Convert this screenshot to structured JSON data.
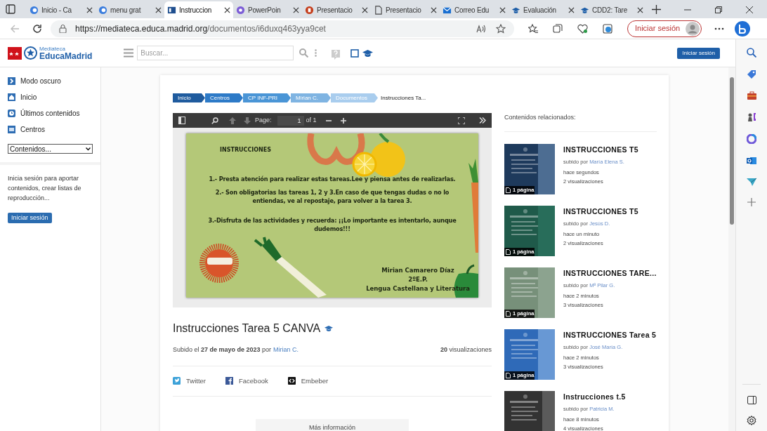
{
  "browser": {
    "tabs": [
      {
        "title": "Inicio - Ca",
        "kind": "edge",
        "selected": false
      },
      {
        "title": "menu grat",
        "kind": "edge",
        "selected": false
      },
      {
        "title": "Instruccion",
        "kind": "site",
        "selected": true
      },
      {
        "title": "PowerPoin",
        "kind": "copilot",
        "selected": false
      },
      {
        "title": "Presentacio",
        "kind": "ppt",
        "selected": false
      },
      {
        "title": "Presentacio",
        "kind": "doc",
        "selected": false
      },
      {
        "title": "Correo Edu",
        "kind": "mail",
        "selected": false
      },
      {
        "title": "Evaluación",
        "kind": "cap",
        "selected": false
      },
      {
        "title": "CDD2: Tare",
        "kind": "cap",
        "selected": false
      }
    ],
    "url_host": "https://mediateca.educa.madrid.org",
    "url_path": "/documentos/i6duxq463yya9cet",
    "sign_in": "Iniciar sesión"
  },
  "header": {
    "logo_small": "Mediateca",
    "logo_big": "EducaMadrid",
    "search_placeholder": "Buscar...",
    "sign_in": "Iniciar sesión"
  },
  "sidebar": {
    "items": [
      {
        "label": "Modo oscuro",
        "kind": "chevron"
      },
      {
        "label": "Inicio",
        "kind": "home"
      },
      {
        "label": "Últimos contenidos",
        "kind": "clock"
      },
      {
        "label": "Centros",
        "kind": "folder"
      }
    ],
    "select": "Contenidos...",
    "note": "Inicia sesión para aportar contenidos, crear listas de reproducción...",
    "button": "Iniciar sesión"
  },
  "breadcrumb": [
    "Inicio",
    "Centros",
    "CP INF-PRI",
    "Mirian C.",
    "Documentos",
    "Instrucciones Ta..."
  ],
  "viewer": {
    "page_label": "Page:",
    "page_value": "1",
    "page_total": "of 1"
  },
  "slide": {
    "heading": "INSTRUCCIONES",
    "lines": [
      "1.- Presta atención  para realizar estas tareas.Lee  y  piensa antes de realizarlas.",
      "2.- Son obligatorias las tareas 1, 2 y 3.En caso de que tengas dudas o no lo entiendas, ve al repostaje, para volver a la tarea 3.",
      "3.-Disfruta de las actividades y recuerda: ¡¡Lo importante es intentarlo, aunque dudemos!!!"
    ],
    "signature": [
      "Mirian Camarero Díaz",
      "2ºE.P.",
      "Lengua Castellana y Literatura"
    ]
  },
  "document": {
    "title": "Instrucciones Tarea 5 CANVA",
    "uploaded": "Subido el **27 de mayo de 2023** por",
    "author": "Mirian C.",
    "views": "**20** visualizaciones",
    "share": [
      {
        "label": "Twitter",
        "kind": "twitter"
      },
      {
        "label": "Facebook",
        "kind": "facebook"
      },
      {
        "label": "Embeber",
        "kind": "embed"
      }
    ],
    "more": "Más información"
  },
  "related": {
    "heading": "Contenidos relacionados:",
    "items": [
      {
        "title": "INSTRUCCIONES T5",
        "by": "subido por",
        "author": "María Elena S.",
        "time": "hace segundos",
        "views": "2 visualizaciones",
        "pages": "1 página",
        "kind": "picture"
      },
      {
        "title": "INSTRUCCIONES T5",
        "by": "subido por",
        "author": "Jesús D.",
        "time": "hace un minuto",
        "views": "2 visualizaciones",
        "pages": "1 página",
        "kind": "picture"
      },
      {
        "title": "INSTRUCCIONES TARE...",
        "by": "subido por",
        "author": "Mª Pilar G.",
        "time": "hace 2 minutos",
        "views": "3 visualizaciones",
        "pages": "1 página",
        "kind": "picture"
      },
      {
        "title": "INSTRUCCIONES Tarea 5",
        "by": "subido por",
        "author": "José María G.",
        "time": "hace 2 minutos",
        "views": "3 visualizaciones",
        "pages": "1 página",
        "kind": "picture"
      },
      {
        "title": "Instrucciones t.5",
        "by": "subido por",
        "author": "Patricia M.",
        "time": "hace 8 minutos",
        "views": "4 visualizaciones",
        "kind": "picture"
      }
    ]
  }
}
